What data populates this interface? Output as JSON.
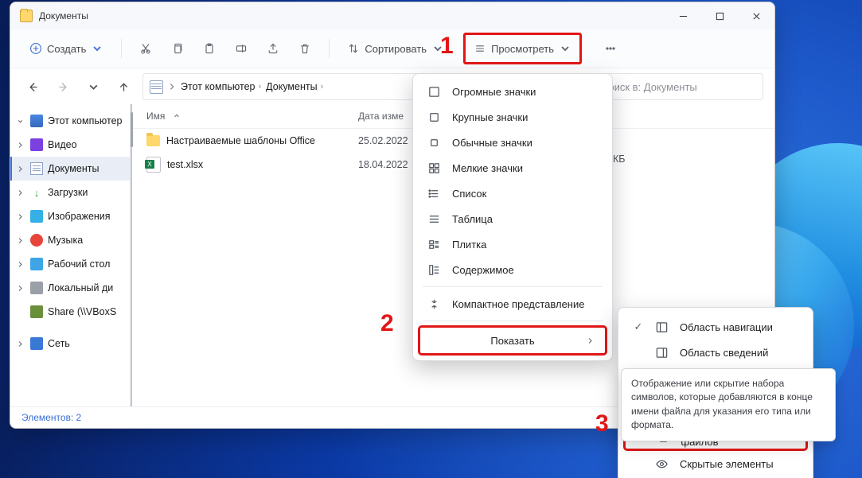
{
  "window_title": "Документы",
  "cmdbar": {
    "create": "Создать",
    "sort": "Сортировать",
    "view": "Просмотреть"
  },
  "breadcrumb": {
    "root": "Этот компьютер",
    "current": "Документы"
  },
  "search_placeholder": "Поиск в: Документы",
  "columns": {
    "name": "Имя",
    "date": "Дата изме"
  },
  "files": [
    {
      "name": "Настраиваемые шаблоны Office",
      "date": "25.02.2022"
    },
    {
      "name": "test.xlsx",
      "date": "18.04.2022"
    }
  ],
  "size_unit_fragment": "КБ",
  "sidebar": {
    "root": "Этот компьютер",
    "items": [
      "Видео",
      "Документы",
      "Загрузки",
      "Изображения",
      "Музыка",
      "Рабочий стол",
      "Локальный ди",
      "Share (\\\\VBoxS"
    ],
    "network": "Сеть"
  },
  "status_bar": "Элементов: 2",
  "view_menu": {
    "items": [
      "Огромные значки",
      "Крупные значки",
      "Обычные значки",
      "Мелкие значки",
      "Список",
      "Таблица",
      "Плитка",
      "Содержимое",
      "Компактное представление",
      "Показать"
    ]
  },
  "show_submenu": {
    "nav": "Область навигации",
    "details": "Область сведений",
    "tooltip": "Отображение или скрытие набора символов, которые добавляются в конце имени файла для указания его типа или формата.",
    "ext": "Расширения имен файлов",
    "hidden": "Скрытые элементы"
  },
  "annot": {
    "one": "1",
    "two": "2",
    "three": "3"
  }
}
